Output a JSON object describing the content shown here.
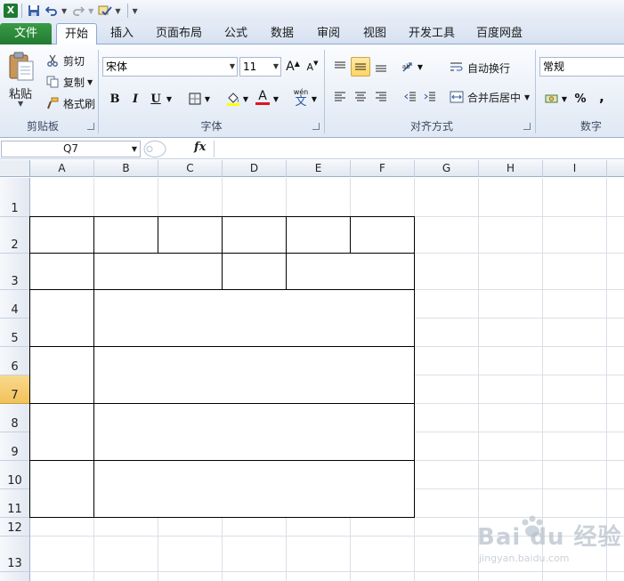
{
  "qat": {
    "excel_icon_letter": "X",
    "save_icon": "save-icon",
    "undo_icon": "undo-icon",
    "redo_icon": "redo-icon"
  },
  "tabs": [
    "文件",
    "开始",
    "插入",
    "页面布局",
    "公式",
    "数据",
    "审阅",
    "视图",
    "开发工具",
    "百度网盘"
  ],
  "active_tab": "开始",
  "clipboard": {
    "paste": "粘贴",
    "cut": "剪切",
    "copy": "复制",
    "format_painter": "格式刷",
    "group": "剪贴板"
  },
  "font": {
    "name": "宋体",
    "size": "11",
    "group": "字体",
    "grow": "A",
    "shrink": "A",
    "bold": "B",
    "italic": "I",
    "underline": "U",
    "font_color": "A",
    "phonetic": "wén"
  },
  "alignment": {
    "wrap_text": "自动换行",
    "merge_center": "合并后居中",
    "group": "对齐方式"
  },
  "number": {
    "format": "常规",
    "percent": "%",
    "comma": ",",
    "group": "数字"
  },
  "formula_bar": {
    "name_box": "Q7",
    "fx": "fx",
    "formula": ""
  },
  "columns": [
    "A",
    "B",
    "C",
    "D",
    "E",
    "F",
    "G",
    "H",
    "I"
  ],
  "rows": [
    "1",
    "2",
    "3",
    "4",
    "5",
    "6",
    "7",
    "8",
    "9",
    "10",
    "11",
    "12",
    "13"
  ],
  "selected_row": "7",
  "watermark": {
    "main": "Bai du 经验",
    "sub": "jingyan.baidu.com"
  },
  "colors": {
    "file_tab": "#217a31",
    "selected_header": "#f2c25a",
    "grid_line": "#dadfe6",
    "table_border": "#000000"
  }
}
